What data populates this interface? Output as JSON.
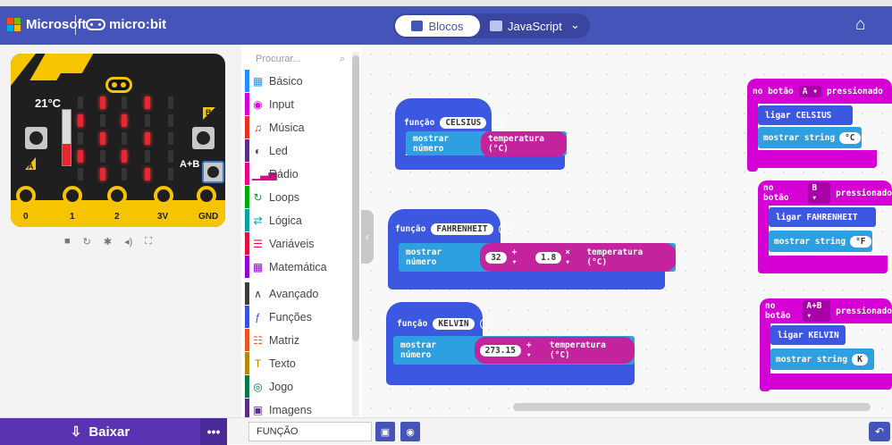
{
  "header": {
    "brand": "Microsoft",
    "product": "micro:bit",
    "tabs": [
      {
        "label": "Blocos",
        "active": true
      },
      {
        "label": "JavaScript",
        "active": false
      }
    ],
    "home_icon": "home-icon"
  },
  "simulator": {
    "temperature": "21°C",
    "button_a": "A",
    "button_b": "B",
    "button_ab": "A+B",
    "pins": [
      "0",
      "1",
      "2",
      "3V",
      "GND"
    ],
    "controls": [
      "stop-icon",
      "restart-icon",
      "slow-motion-icon",
      "mute-icon",
      "fullscreen-icon"
    ],
    "led_matrix": [
      [
        0,
        1,
        0,
        1,
        0
      ],
      [
        1,
        0,
        1,
        0,
        0
      ],
      [
        0,
        1,
        0,
        1,
        0
      ],
      [
        1,
        0,
        1,
        0,
        0
      ],
      [
        0,
        1,
        0,
        1,
        0
      ]
    ]
  },
  "palette": {
    "search_placeholder": "Procurar...",
    "categories": [
      {
        "label": "Básico",
        "color": "#1e90ff",
        "icon": "grid-icon"
      },
      {
        "label": "Input",
        "color": "#d400d4",
        "icon": "target-icon"
      },
      {
        "label": "Música",
        "color": "#e63022",
        "icon": "headphones-icon"
      },
      {
        "label": "Led",
        "color": "#5c2d91",
        "icon": "toggle-icon"
      },
      {
        "label": "Rádio",
        "color": "#e3008c",
        "icon": "signal-icon"
      },
      {
        "label": "Loops",
        "color": "#00aa00",
        "icon": "refresh-icon"
      },
      {
        "label": "Lógica",
        "color": "#00a4a6",
        "icon": "shuffle-icon"
      },
      {
        "label": "Variáveis",
        "color": "#dc143c",
        "icon": "lines-icon"
      },
      {
        "label": "Matemática",
        "color": "#9400d3",
        "icon": "calculator-icon"
      },
      {
        "label": "Avançado",
        "color": "#3c3c3c",
        "icon": "chevron-up-icon"
      },
      {
        "label": "Funções",
        "color": "#3455db",
        "icon": "function-icon"
      },
      {
        "label": "Matriz",
        "color": "#e65722",
        "icon": "list-icon"
      },
      {
        "label": "Texto",
        "color": "#b8860b",
        "icon": "text-icon"
      },
      {
        "label": "Jogo",
        "color": "#007a4b",
        "icon": "gamepad-icon"
      },
      {
        "label": "Imagens",
        "color": "#5c2d91",
        "icon": "image-icon"
      }
    ]
  },
  "workspace": {
    "function_keyword": "função",
    "show_number": "mostrar número",
    "show_string": "mostrar string",
    "call_keyword": "ligar",
    "on_button": "no botão",
    "pressed": "pressionado",
    "temperature_reporter": "temperatura (°C)",
    "functions": [
      {
        "name": "CELSIUS"
      },
      {
        "name": "FAHRENHEIT",
        "value1": "32",
        "op1": "+ ▾",
        "value2": "1.8",
        "op2": "× ▾"
      },
      {
        "name": "KELVIN",
        "value1": "273.15",
        "op1": "+ ▾"
      }
    ],
    "events": [
      {
        "button": "A ▾",
        "call": "CELSIUS",
        "string": "°C"
      },
      {
        "button": "B ▾",
        "call": "FAHRENHEIT",
        "string": "°F"
      },
      {
        "button": "A+B ▾",
        "call": "KELVIN",
        "string": "K"
      }
    ]
  },
  "footer": {
    "download_label": "Baixar",
    "more_label": "•••",
    "project_name": "FUNÇÃO"
  }
}
